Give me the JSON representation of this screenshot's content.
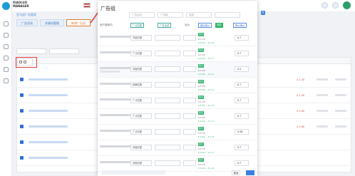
{
  "brand": {
    "name": "XIAOLUO MANAGER",
    "subtitle": ""
  },
  "page": {
    "breadcrumb": "亚马逊广告管理",
    "tabs": [
      {
        "label": "广告活动"
      },
      {
        "label": "关键词管理"
      },
      {
        "label": "新增广告组"
      }
    ],
    "table_numbers": [
      "$ 2.38",
      "$ 1.98",
      "$ 0.66",
      "$ 0.66"
    ]
  },
  "modal": {
    "title": "广告组",
    "filters": [
      {
        "placeholder": "广告活动"
      },
      {
        "placeholder": "广告组"
      },
      {
        "placeholder": "搜索"
      },
      {
        "placeholder": ""
      }
    ],
    "close_label": "×",
    "header": {
      "col_name": "用户搜索词",
      "btn_match": "广泛匹配",
      "btn_adgroup": "广告活动",
      "col_bid": "出价",
      "btn_suggest": "建议竞价",
      "badge_label": "应用",
      "btn_custom": "默认竞价"
    },
    "rows": [
      {
        "match": "词组匹配",
        "adgroup": "",
        "bid": "",
        "tag": "建议",
        "price1": "$ 1.73",
        "price2": "$ 0.41 ~ $ 1.8",
        "input": "0.7"
      },
      {
        "match": "广泛匹配",
        "adgroup": "",
        "bid": "",
        "tag": "建议",
        "price1": "$ 1.73",
        "price2": "$ 0.41 ~ $ 1.7",
        "input": "0.7"
      },
      {
        "match": "词组匹配",
        "adgroup": "",
        "bid": "",
        "tag": "建议",
        "price1": "$ 1.73",
        "price2": "$ 0.41 ~ $ 1.2",
        "input": "0.5"
      },
      {
        "match": "精确匹配",
        "adgroup": "",
        "bid": "",
        "tag": "建议",
        "price1": "$ 1.73",
        "price2": "$ 0.41 ~ $ 1.8",
        "input": "0.7"
      },
      {
        "match": "广泛匹配",
        "adgroup": "",
        "bid": "",
        "tag": "建议",
        "price1": "$ 1.73",
        "price2": "$ 0.41 ~ $ 1.8",
        "input": "0.7"
      },
      {
        "match": "广泛匹配",
        "adgroup": "",
        "bid": "",
        "tag": "建议",
        "price1": "$ 1.73",
        "price2": "$ 0.41 ~ $ 1.2",
        "input": "0.7"
      },
      {
        "match": "广泛匹配",
        "adgroup": "",
        "bid": "",
        "tag": "建议",
        "price1": "$ 1.73",
        "price2": "$ 0.41 ~ $ 1.8",
        "input": "0.56"
      },
      {
        "match": "词组匹配",
        "adgroup": "",
        "bid": "",
        "tag": "建议",
        "price1": "$ 1.73",
        "price2": "$ 0.41 ~ $ 1.2",
        "input": "0.7"
      },
      {
        "match": "词组匹配",
        "adgroup": "",
        "bid": "",
        "tag": "建议",
        "price1": "$ 1.73",
        "price2": "$ 0.41 ~ $ 1.8",
        "input": "0.7"
      }
    ],
    "footer": {
      "cancel_label": "取消"
    }
  },
  "colors": {
    "accent": "#3c7fe0",
    "annotation": "#e23b3b",
    "success": "#2fb36a"
  }
}
